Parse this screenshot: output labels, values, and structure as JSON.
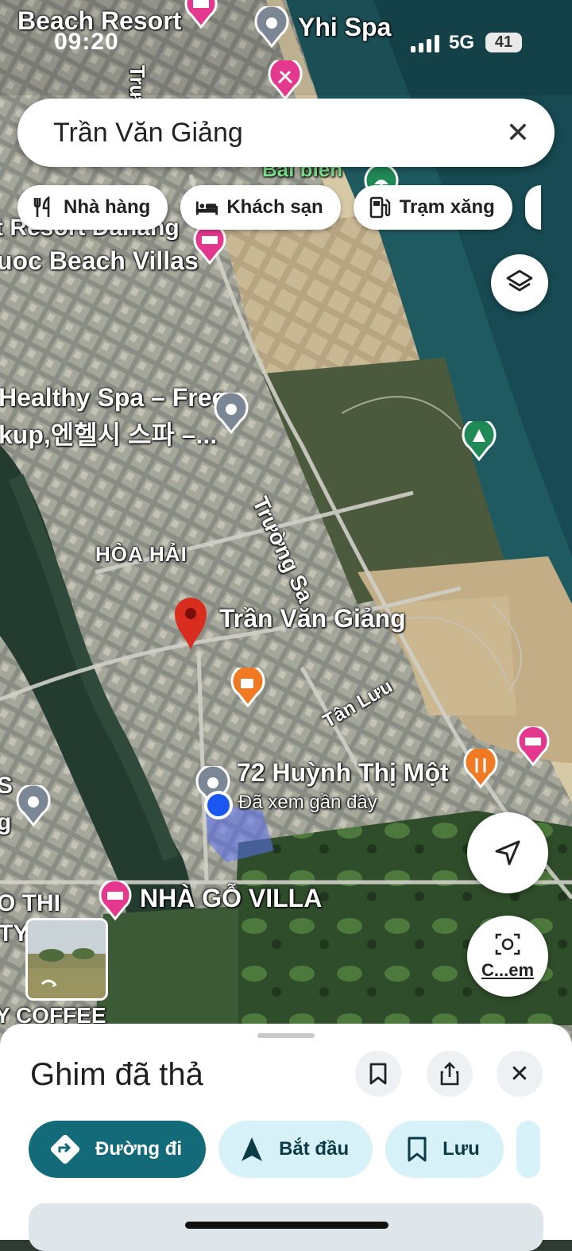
{
  "status": {
    "time": "09:20",
    "network": "5G",
    "battery": "41"
  },
  "search": {
    "query": "Trần Văn Giảng",
    "close_icon": "close-icon"
  },
  "chips": [
    {
      "label": "Nhà hàng",
      "icon": "restaurant-icon"
    },
    {
      "label": "Khách sạn",
      "icon": "hotel-icon"
    },
    {
      "label": "Trạm xăng",
      "icon": "gas-station-icon"
    }
  ],
  "map": {
    "labels": {
      "beach_resort": "Beach Resort",
      "yhi_spa": "Yhi Spa",
      "bai_bien": "Bãi biển",
      "resort_danang": "t Resort Danang",
      "beach_villas": "uoc Beach Villas",
      "healthy_spa_1": "Healthy Spa – Free",
      "healthy_spa_2": "kup,엔헬시 스파 –...",
      "truong_sa": "Trường Sa",
      "hoa_hai": "HÒA HẢI",
      "dropped_pin_label": "Trần Văn Giảng",
      "tan_luu": "Tân Lưu",
      "address": "72 Huỳnh Thị Một",
      "recently_viewed": "Đã xem gần đây",
      "nha_go_villa": "NHÀ GỖ VILLA",
      "edge_thi": "O THI",
      "edge_ty": "TY",
      "edge_coffee": "Y COFFEE",
      "edge_s": "S",
      "edge_g": "g",
      "street_vertical_top": "Trư"
    },
    "camera_label": "C...em"
  },
  "sheet": {
    "title": "Ghim đã thả",
    "actions": [
      {
        "label": "Đường đi",
        "icon": "directions-icon"
      },
      {
        "label": "Bắt đầu",
        "icon": "navigation-start-icon"
      },
      {
        "label": "Lưu",
        "icon": "bookmark-icon"
      }
    ]
  },
  "colors": {
    "primary_action": "#136b7a",
    "secondary_action": "#d7f1f8",
    "pin_red": "#d92d20",
    "location_blue": "#1a56f0",
    "poi_pink": "#e4388f",
    "poi_orange": "#f07a24",
    "poi_green": "#1f8a55",
    "poi_gray": "#7b8794"
  }
}
